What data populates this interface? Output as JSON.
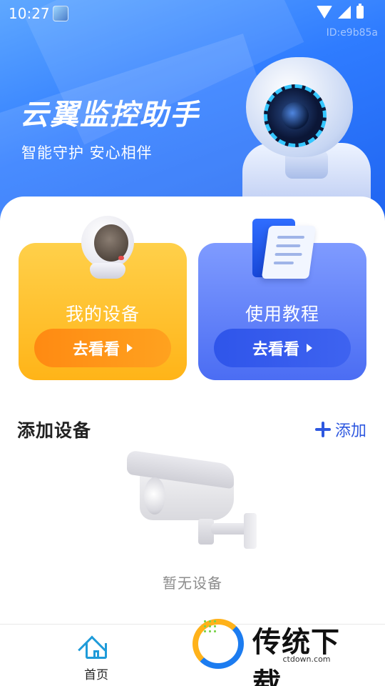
{
  "status_bar": {
    "time": "10:27"
  },
  "device_id": "ID:e9b85a",
  "header": {
    "title": "云翼监控助手",
    "subtitle": "智能守护 安心相伴"
  },
  "features": [
    {
      "title": "我的设备",
      "button": "去看看"
    },
    {
      "title": "使用教程",
      "button": "去看看"
    }
  ],
  "add_section": {
    "title": "添加设备",
    "add_label": "添加",
    "empty_text": "暂无设备"
  },
  "bottom_nav": {
    "home_label": "首页"
  },
  "watermark": {
    "brand": "传统下载",
    "url": "ctdown.com"
  },
  "colors": {
    "primary_blue": "#2f7cff",
    "accent_orange": "#ffb418",
    "link_blue": "#2e58e0",
    "nav_icon": "#1f9bd9"
  },
  "icons": [
    "wifi-icon",
    "cell-signal-icon",
    "battery-icon",
    "play-icon",
    "plus-icon",
    "home-icon"
  ]
}
